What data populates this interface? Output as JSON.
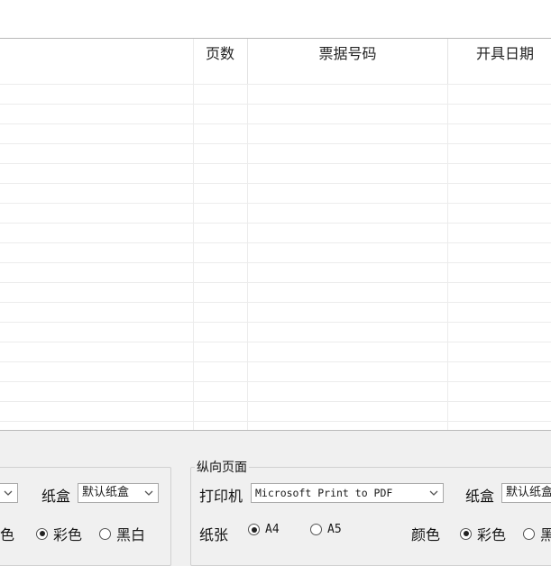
{
  "table": {
    "columns": [
      "页数",
      "票据号码",
      "开具日期"
    ]
  },
  "left_panel": {
    "tray_label": "纸盒",
    "tray_value": "默认纸盒",
    "color_label_partial": "颜色",
    "color_options": [
      "彩色",
      "黑白"
    ],
    "color_selected": "彩色"
  },
  "right_panel": {
    "title": "纵向页面",
    "printer_label": "打印机",
    "printer_value": "Microsoft Print to PDF",
    "tray_label": "纸盒",
    "tray_value": "默认纸盒",
    "paper_label": "纸张",
    "paper_options": [
      "A4",
      "A5"
    ],
    "paper_selected": "A4",
    "color_label": "颜色",
    "color_options": [
      "彩色",
      "黑白"
    ],
    "color_selected": "彩色"
  },
  "icons": {
    "dropdown": "chevron-down-icon"
  }
}
